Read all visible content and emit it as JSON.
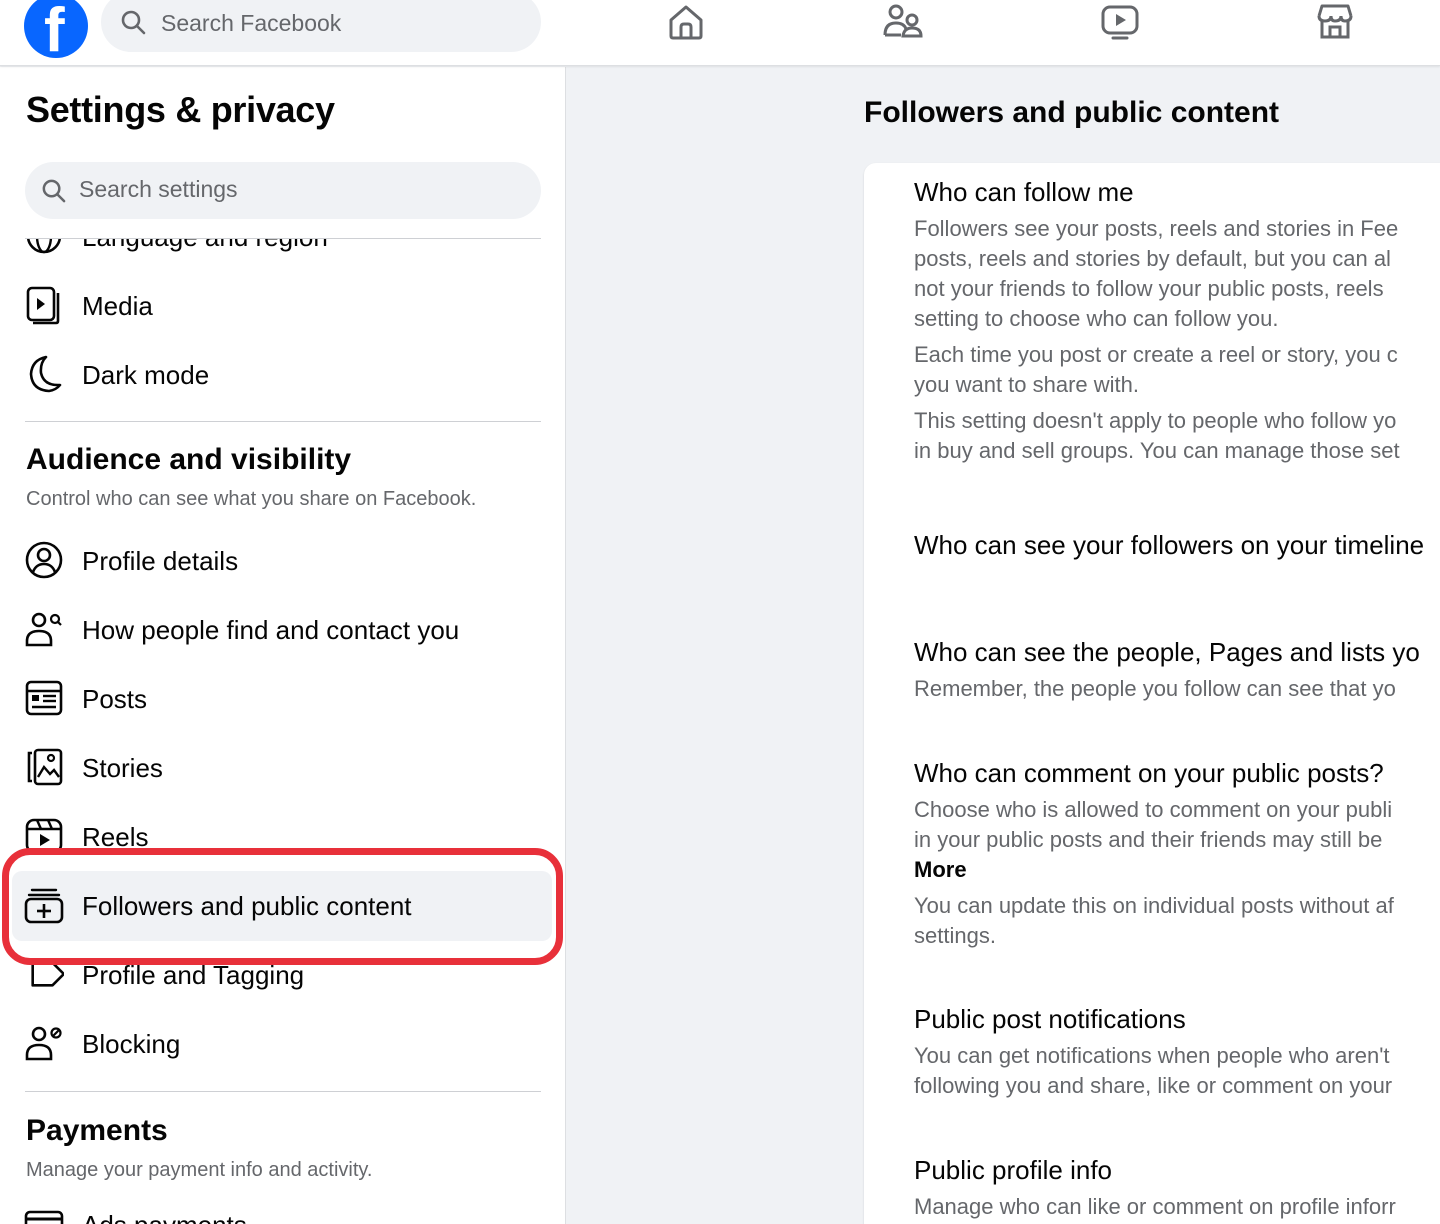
{
  "topbar": {
    "logo": "f",
    "search_placeholder": "Search Facebook",
    "nav_icons": [
      "home-icon",
      "friends-icon",
      "video-icon",
      "marketplace-icon"
    ]
  },
  "sidebar": {
    "title": "Settings & privacy",
    "search_placeholder": "Search settings",
    "partial_item": "Language and region",
    "preferences_items": [
      {
        "label": "Media",
        "icon": "media-icon"
      },
      {
        "label": "Dark mode",
        "icon": "moon-icon"
      }
    ],
    "audience": {
      "title": "Audience and visibility",
      "subtitle": "Control who can see what you share on Facebook.",
      "items": [
        {
          "label": "Profile details",
          "icon": "profile-icon"
        },
        {
          "label": "How people find and contact you",
          "icon": "find-people-icon"
        },
        {
          "label": "Posts",
          "icon": "posts-icon"
        },
        {
          "label": "Stories",
          "icon": "stories-icon"
        },
        {
          "label": "Reels",
          "icon": "reels-icon"
        },
        {
          "label": "Followers and public content",
          "icon": "followers-icon",
          "active": true
        },
        {
          "label": "Profile and Tagging",
          "icon": "tag-icon"
        },
        {
          "label": "Blocking",
          "icon": "blocking-icon"
        }
      ]
    },
    "payments": {
      "title": "Payments",
      "subtitle": "Manage your payment info and activity.",
      "partial_item": "Ads payments"
    }
  },
  "main": {
    "title": "Followers and public content",
    "sections": {
      "follow": {
        "title": "Who can follow me",
        "p1": [
          "Followers see your posts, reels and stories in Fee",
          "posts, reels and stories by default, but you can al",
          "not your friends to follow your public posts, reels",
          "setting to choose who can follow you."
        ],
        "p2": [
          "Each time you post or create a reel or story, you c",
          "you want to share with."
        ],
        "p3": [
          "This setting doesn't apply to people who follow yo",
          "in buy and sell groups. You can manage those set"
        ]
      },
      "followers_timeline": {
        "title": "Who can see your followers on your timeline"
      },
      "following": {
        "title": "Who can see the people, Pages and lists yo",
        "desc": "Remember, the people you follow can see that yo"
      },
      "comments": {
        "title": "Who can comment on your public posts?",
        "p1": [
          "Choose who is allowed to comment on your publi",
          "in your public posts and their friends may still be "
        ],
        "more": "More",
        "p2": [
          "You can update this on individual posts without af",
          "settings."
        ]
      },
      "notifications": {
        "title": "Public post notifications",
        "desc": [
          "You can get notifications when people who aren't",
          "following you and share, like or comment on your"
        ]
      },
      "profile_info": {
        "title": "Public profile info",
        "desc": "Manage who can like or comment on profile inforr"
      }
    }
  },
  "colors": {
    "brand": "#0866ff",
    "highlight": "#e8303a",
    "muted": "#65676b"
  }
}
